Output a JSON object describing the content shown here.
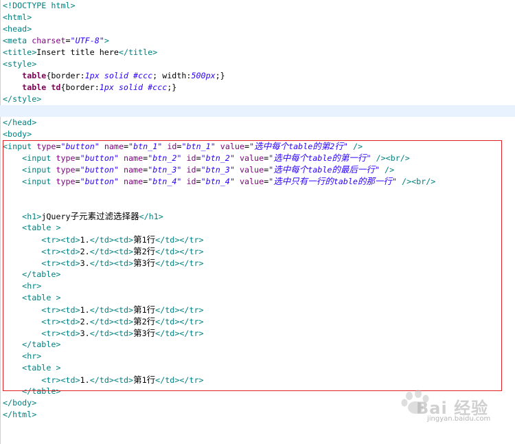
{
  "editor": {
    "lines": [
      "<!DOCTYPE html>",
      "<html>",
      "<head>",
      "<meta charset=\"UTF-8\">",
      "<title>Insert title here</title>",
      "<style>",
      "    table{border:1px solid #ccc; width:500px;}",
      "    table td{border:1px solid #ccc;}",
      "</style>",
      "",
      "</head>",
      "<body>",
      "<input type=\"button\" name=\"btn_1\" id=\"btn_1\" value=\"选中每个table的第2行\" />",
      "    <input type=\"button\" name=\"btn_2\" id=\"btn_2\" value=\"选中每个table的第一行\" /><br/>",
      "    <input type=\"button\" name=\"btn_3\" id=\"btn_3\" value=\"选中每个table的最后一行\" />",
      "    <input type=\"button\" name=\"btn_4\" id=\"btn_4\" value=\"选中只有一行的table的那一行\" /><br/>",
      "",
      "",
      "    <h1>jQuery子元素过滤选择器</h1>",
      "    <table >",
      "        <tr><td>1.</td><td>第1行</td></tr>",
      "        <tr><td>2.</td><td>第2行</td></tr>",
      "        <tr><td>3.</td><td>第3行</td></tr>",
      "    </table>",
      "    <hr>",
      "    <table >",
      "        <tr><td>1.</td><td>第1行</td></tr>",
      "        <tr><td>2.</td><td>第2行</td></tr>",
      "        <tr><td>3.</td><td>第3行</td></tr>",
      "    </table>",
      "    <hr>",
      "    <table >",
      "        <tr><td>1.</td><td>第1行</td></tr>",
      "    </table>",
      "</body>",
      "</html>"
    ],
    "highlighted_line": 9
  },
  "watermark": {
    "brand": "Bai 经验",
    "url": "jingyan.baidu.com"
  },
  "colors": {
    "tag": "#008080",
    "attribute": "#7f007f",
    "value": "#2a00ff",
    "keyword": "#7f0055",
    "selection": "#e02020",
    "current_line": "#e8f2fe"
  }
}
